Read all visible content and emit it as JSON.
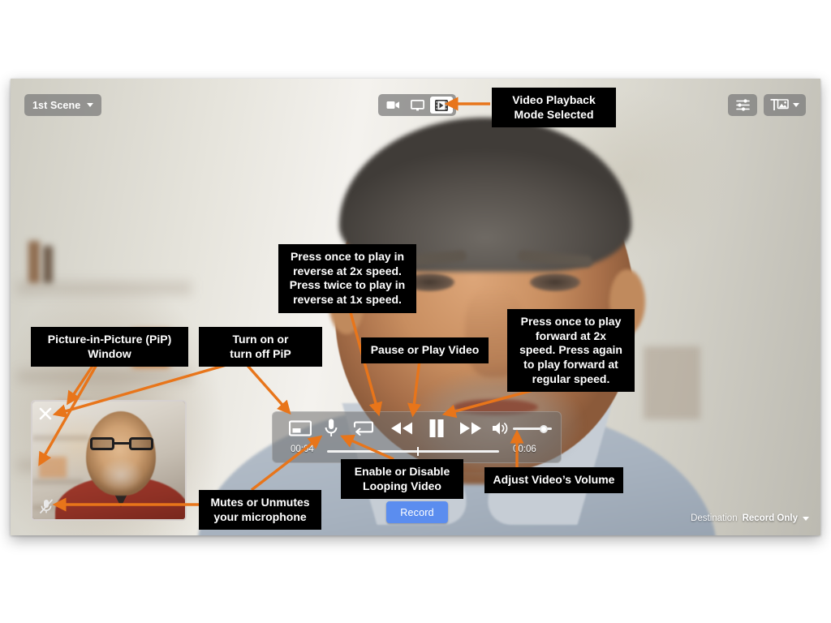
{
  "app": {
    "scene_selector_label": "1st Scene",
    "record_button_label": "Record",
    "destination_label": "Destination",
    "destination_value": "Record Only"
  },
  "mode_switcher": {
    "modes": [
      {
        "name": "webcam-mode",
        "icon": "camera-icon",
        "selected": false
      },
      {
        "name": "screen-mode",
        "icon": "monitor-icon",
        "selected": false
      },
      {
        "name": "video-playback-mode",
        "icon": "film-strip-icon",
        "selected": true
      }
    ]
  },
  "top_right_buttons": [
    {
      "name": "settings-button",
      "icon": "sliders-icon"
    },
    {
      "name": "overlay-button",
      "icon": "text-image-icon"
    }
  ],
  "player": {
    "time_current": "00:04",
    "time_total": "00:06",
    "volume_level_pct": 75,
    "scrub_position_pct": 52,
    "controls": [
      {
        "name": "pip-toggle",
        "icon": "pip-icon"
      },
      {
        "name": "mic-toggle",
        "icon": "microphone-icon"
      },
      {
        "name": "loop-toggle",
        "icon": "loop-icon"
      },
      {
        "name": "rewind-button",
        "icon": "rewind-icon"
      },
      {
        "name": "pause-button",
        "icon": "pause-icon"
      },
      {
        "name": "forward-button",
        "icon": "fast-forward-icon"
      },
      {
        "name": "volume-icon",
        "icon": "speaker-icon"
      }
    ]
  },
  "pip": {
    "close_icon": "close-x-icon",
    "mic_icon": "microphone-muted-icon"
  },
  "callouts": {
    "video_mode": "Video Playback\nMode Selected",
    "reverse": "Press once to play in\nreverse at 2x speed.\nPress twice to play in\nreverse at 1x speed.",
    "forward": "Press once to play\nforward at 2x\nspeed. Press again\nto play forward at\nregular speed.",
    "pip_window": "Picture-in-Picture (PiP)\nWindow",
    "pip_toggle": "Turn on or\nturn off PiP",
    "pause": "Pause or Play Video",
    "loop": "Enable or Disable\nLooping Video",
    "volume": "Adjust Video’s Volume",
    "mic": "Mutes or Unmutes\nyour microphone"
  },
  "colors": {
    "annotation_arrow": "#E8751A",
    "callout_background": "#000000",
    "callout_text": "#FFFFFF",
    "record_button": "#5B8DEF",
    "control_bar": "rgba(110,110,110,0.55)"
  }
}
